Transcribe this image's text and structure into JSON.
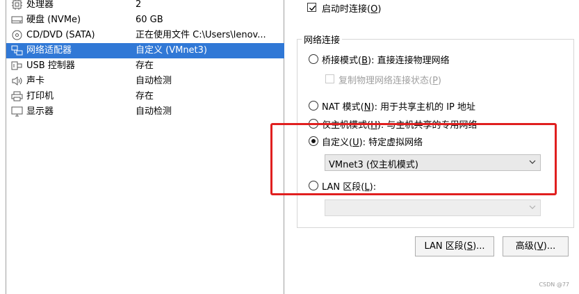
{
  "devices": [
    {
      "name": "处理器",
      "summary": "2",
      "icon": "cpu-icon"
    },
    {
      "name": "硬盘 (NVMe)",
      "summary": "60 GB",
      "icon": "hard-disk-icon"
    },
    {
      "name": "CD/DVD (SATA)",
      "summary": "正在使用文件 C:\\Users\\lenov...",
      "icon": "cd-dvd-icon"
    },
    {
      "name": "网络适配器",
      "summary": "自定义 (VMnet3)",
      "icon": "network-adapter-icon",
      "selected": true
    },
    {
      "name": "USB 控制器",
      "summary": "存在",
      "icon": "usb-icon"
    },
    {
      "name": "声卡",
      "summary": "自动检测",
      "icon": "speaker-icon"
    },
    {
      "name": "打印机",
      "summary": "存在",
      "icon": "printer-icon"
    },
    {
      "name": "显示器",
      "summary": "自动检测",
      "icon": "monitor-icon"
    }
  ],
  "connect_at_power_on": {
    "label": "启动时连接(",
    "key": "O",
    "suffix": ")",
    "checked": true
  },
  "network_connection": {
    "title": "网络连接",
    "bridged": {
      "prefix": "桥接模式(",
      "key": "B",
      "suffix": "): 直接连接物理网络"
    },
    "replicate": {
      "prefix": "复制物理网络连接状态(",
      "key": "P",
      "suffix": ")"
    },
    "nat": {
      "prefix": "NAT 模式(",
      "key": "N",
      "suffix": "): 用于共享主机的 IP 地址"
    },
    "host_only": {
      "prefix": "仅主机模式(",
      "key": "H",
      "suffix": "): 与主机共享的专用网络"
    },
    "custom": {
      "prefix": "自定义(",
      "key": "U",
      "suffix": "): 特定虚拟网络",
      "checked": true
    },
    "custom_select_value": "VMnet3 (仅主机模式)",
    "lan_segment": {
      "prefix": "LAN 区段(",
      "key": "L",
      "suffix": "):"
    },
    "lan_segment_select_value": ""
  },
  "buttons": {
    "lan_segments": {
      "prefix": "LAN 区段(",
      "key": "S",
      "suffix": ")..."
    },
    "advanced": {
      "prefix": "高级(",
      "key": "V",
      "suffix": ")..."
    }
  },
  "watermark": "CSDN @77",
  "highlight_color": "#e01f1f",
  "selection_color": "#3078d6"
}
